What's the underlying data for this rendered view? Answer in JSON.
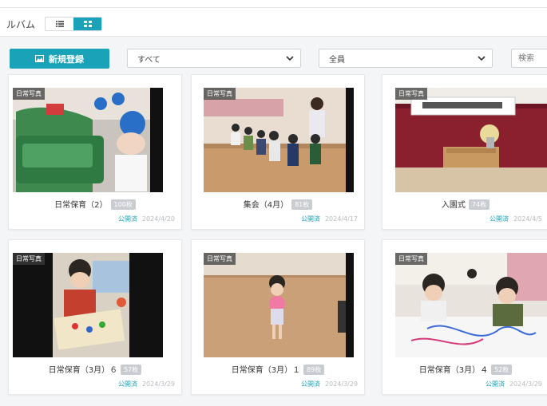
{
  "header": {
    "title": "ルバム",
    "view_toggle": {
      "list_icon": "list-icon",
      "grid_icon": "grid-icon",
      "active": "grid"
    }
  },
  "toolbar": {
    "new_button_label": "新規登録",
    "new_button_icon": "image-icon",
    "filter1_value": "すべて",
    "filter2_value": "全員",
    "search_placeholder": "検索"
  },
  "colors": {
    "accent": "#1aa3b8",
    "public": "#1aa3b8",
    "badge": "#c9cdd2"
  },
  "albums": [
    {
      "tag": "日常写真",
      "title": "日常保育（2）",
      "count": "100枚",
      "status": "公開済",
      "date": "2024/4/20"
    },
    {
      "tag": "日常写真",
      "title": "集会（4月）",
      "count": "81枚",
      "status": "公開済",
      "date": "2024/4/17"
    },
    {
      "tag": "日常写真",
      "title": "入園式",
      "count": "74枚",
      "status": "公開済",
      "date": "2024/4/5"
    },
    {
      "tag": "日常写真",
      "title": "日常保育（3月）６",
      "count": "57枚",
      "status": "公開済",
      "date": "2024/3/29"
    },
    {
      "tag": "日常写真",
      "title": "日常保育（3月）１",
      "count": "89枚",
      "status": "公開済",
      "date": "2024/3/29"
    },
    {
      "tag": "日常写真",
      "title": "日常保育（3月）４",
      "count": "52枚",
      "status": "公開済",
      "date": "2024/3/29"
    }
  ]
}
